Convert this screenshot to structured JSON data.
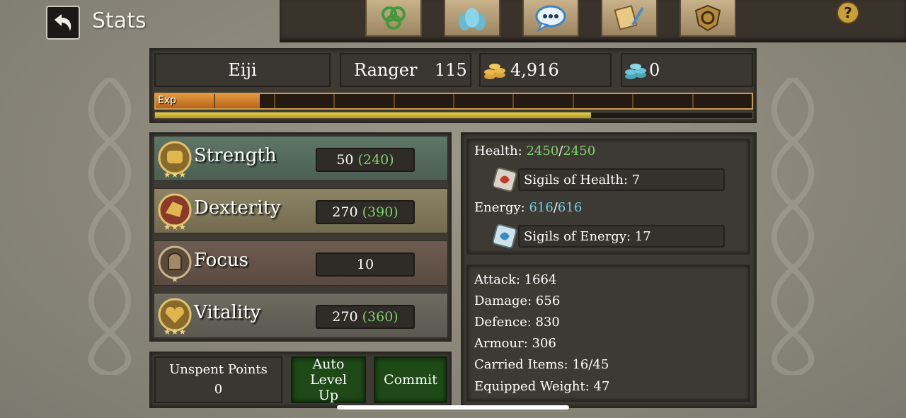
{
  "header": {
    "title": "Stats",
    "help": "?"
  },
  "tabs": [
    {
      "icon": "triskelion-icon"
    },
    {
      "icon": "party-icon"
    },
    {
      "icon": "chat-icon"
    },
    {
      "icon": "quest-scroll-icon"
    },
    {
      "icon": "guild-shield-icon"
    }
  ],
  "character": {
    "name": "Eiji",
    "class": "Ranger",
    "level": "115",
    "gold": "4,916",
    "crystals": "0",
    "exp_label": "Exp",
    "exp_progress": 0.175,
    "sub_progress": 0.73
  },
  "stats": [
    {
      "name": "Strength",
      "base": "50",
      "total": "(240)",
      "icon": "strength-fist-icon"
    },
    {
      "name": "Dexterity",
      "base": "270",
      "total": "(390)",
      "icon": "dexterity-gauntlet-icon"
    },
    {
      "name": "Focus",
      "base": "10",
      "total": "",
      "icon": "focus-helm-icon"
    },
    {
      "name": "Vitality",
      "base": "270",
      "total": "(360)",
      "icon": "vitality-heart-icon"
    }
  ],
  "resources": {
    "health_label": "Health:",
    "health_current": "2450",
    "health_max": "2450",
    "sigils_health": "Sigils of Health: 7",
    "energy_label": "Energy:",
    "energy_current": "616",
    "energy_max": "616",
    "sigils_energy": "Sigils of Energy: 17",
    "slash": "/"
  },
  "attributes": [
    "Attack: 1664",
    "Damage: 656",
    "Defence: 830",
    "Armour: 306",
    "Carried Items: 16/45",
    "Equipped Weight: 47"
  ],
  "footer": {
    "unspent_label": "Unspent Points",
    "unspent_value": "0",
    "auto_label": "Auto Level Up",
    "commit_label": "Commit"
  },
  "colors": {
    "green": "#7fd26b",
    "blue": "#6fd0ee",
    "exp": "#e39a3e",
    "gold": "#c9a13b"
  }
}
